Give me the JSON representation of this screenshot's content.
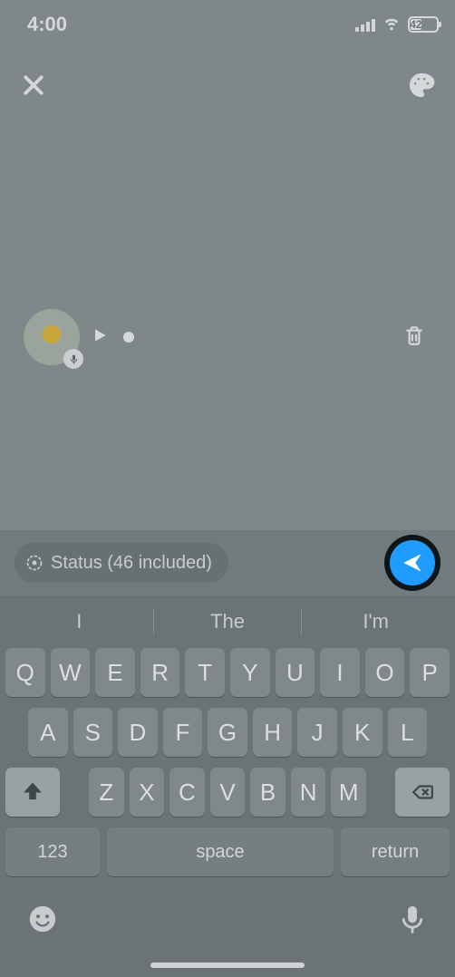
{
  "status_bar": {
    "time": "4:00",
    "battery_pct": 42
  },
  "voice_status": {
    "recipient_label": "Status (46 included)"
  },
  "keyboard": {
    "suggestions": [
      "I",
      "The",
      "I'm"
    ],
    "row1": [
      "Q",
      "W",
      "E",
      "R",
      "T",
      "Y",
      "U",
      "I",
      "O",
      "P"
    ],
    "row2": [
      "A",
      "S",
      "D",
      "F",
      "G",
      "H",
      "J",
      "K",
      "L"
    ],
    "row3": [
      "Z",
      "X",
      "C",
      "V",
      "B",
      "N",
      "M"
    ],
    "numbers_label": "123",
    "space_label": "space",
    "return_label": "return"
  }
}
